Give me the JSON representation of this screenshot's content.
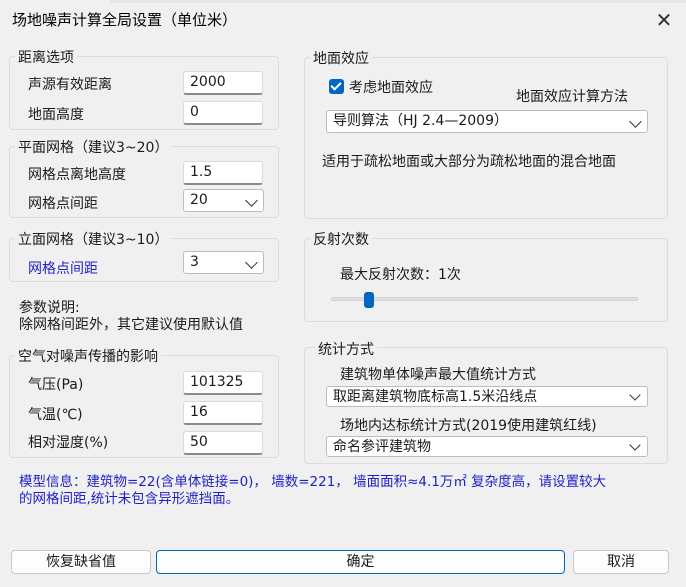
{
  "window": {
    "title": "场地噪声计算全局设置（单位米）",
    "close_glyph": "✕"
  },
  "distance": {
    "legend": "距离选项",
    "source_distance_label": "声源有效距离",
    "source_distance_value": "2000",
    "ground_height_label": "地面高度",
    "ground_height_value": "0"
  },
  "plane_grid": {
    "legend": "平面网格（建议3~20）",
    "height_label": "网格点离地高度",
    "height_value": "1.5",
    "spacing_label": "网格点间距",
    "spacing_value": "20"
  },
  "facade_grid": {
    "legend": "立面网格（建议3~10）",
    "spacing_label": "网格点间距",
    "spacing_value": "3"
  },
  "notes": {
    "title": "参数说明:",
    "text": "除网格间距外，其它建议使用默认值"
  },
  "air": {
    "legend": "空气对噪声传播的影响",
    "pressure_label": "气压(Pa)",
    "pressure_value": "101325",
    "temperature_label": "气温(℃)",
    "temperature_value": "16",
    "humidity_label": "相对湿度(%)",
    "humidity_value": "50"
  },
  "ground_effect": {
    "legend": "地面效应",
    "consider_label": "考虑地面效应",
    "consider_checked": true,
    "method_label": "地面效应计算方法",
    "method_value": "导则算法（HJ 2.4—2009）",
    "description": "适用于疏松地面或大部分为疏松地面的混合地面"
  },
  "reflection": {
    "legend": "反射次数",
    "max_label": "最大反射次数：1次",
    "max_value": 1
  },
  "statistics": {
    "legend": "统计方式",
    "building_max_label": "建筑物单体噪声最大值统计方式",
    "building_max_value": "取距离建筑物底标高1.5米沿线点",
    "site_label": "场地内达标统计方式(2019使用建筑红线)",
    "site_value": "命名参评建筑物"
  },
  "model_info": {
    "line1": "模型信息：建筑物=22(含单体链接=0)， 墙数=221， 墙面面积≈4.1万㎡ 复杂度高，请设置较大",
    "line2": "的网格间距,统计未包含异形遮挡面。"
  },
  "buttons": {
    "restore": "恢复缺省值",
    "ok": "确定",
    "cancel": "取消"
  },
  "colors": {
    "accent": "#0067c0",
    "info_text": "#1f1fc8"
  }
}
